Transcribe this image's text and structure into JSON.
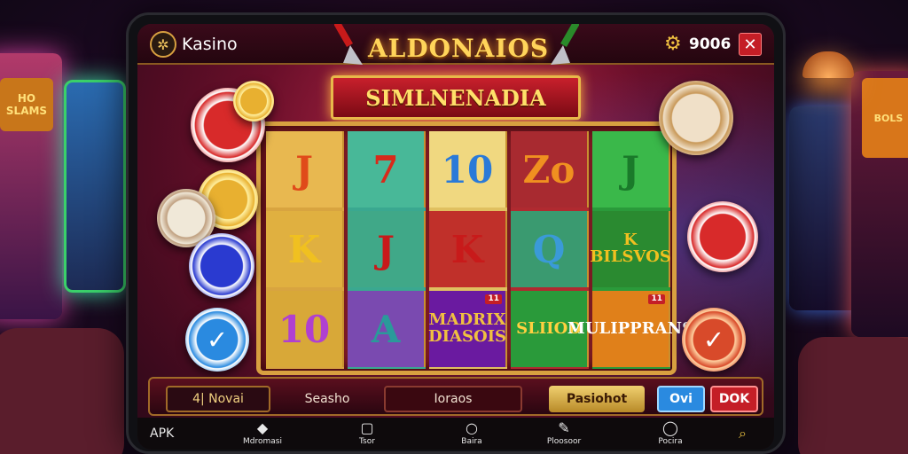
{
  "background": {
    "left_sign": "HO SLAMS",
    "right_sign": "BOLS"
  },
  "topbar": {
    "logo_glyph": "✲",
    "app_name": "Kasino",
    "title": "ALDONAIOS",
    "gear_icon": "gear-icon",
    "coins": "9006",
    "close_glyph": "✕"
  },
  "game": {
    "banner": "SIMLNENADIA"
  },
  "reels": [
    {
      "bg": "#d8a440",
      "cells": [
        {
          "text": "J",
          "color": "#e04a1a",
          "bg": "#e8b850"
        },
        {
          "text": "K",
          "color": "#f0c020",
          "bg": "#e0b040"
        },
        {
          "text": "10",
          "color": "#b040d0",
          "bg": "#d8a838"
        }
      ]
    },
    {
      "bg": "#3aa890",
      "cells": [
        {
          "text": "7",
          "color": "#d82a1a",
          "bg": "#48b898"
        },
        {
          "text": "J",
          "color": "#c81a1a",
          "bg": "#40a888"
        },
        {
          "text": "A",
          "color": "#2a9a9a",
          "bg": "#7a4ab0"
        }
      ]
    },
    {
      "bg": "#e0c060",
      "cells": [
        {
          "text": "10",
          "color": "#2a7ad8",
          "bg": "#f0d880"
        },
        {
          "text": "K",
          "color": "#c81a1a",
          "bg": "#c0302a"
        },
        {
          "text": "MADRIX DIASOIS",
          "color": "#f0c040",
          "bg": "#6a1aa0",
          "small": true,
          "badge": "11"
        }
      ]
    },
    {
      "bg": "#b02a30",
      "cells": [
        {
          "text": "Zo",
          "color": "#f09020",
          "bg": "#a82a30"
        },
        {
          "text": "Q",
          "color": "#3a9ad8",
          "bg": "#3a9a70"
        },
        {
          "text": "SLIIOD",
          "color": "#ffd040",
          "bg": "#2a9a3a",
          "small": true
        }
      ]
    },
    {
      "bg": "#2a9a3a",
      "cells": [
        {
          "text": "J",
          "color": "#1a7a2a",
          "bg": "#3ab84a"
        },
        {
          "text": "K BILSVOS",
          "color": "#f0c020",
          "bg": "#2a8a30",
          "small": true
        },
        {
          "text": "MULIPPRANS",
          "color": "#ffffff",
          "bg": "#e0801a",
          "small": true,
          "badge": "11"
        }
      ]
    }
  ],
  "chips": [
    {
      "label": "",
      "bg": "#d82a2a",
      "edge": "#ffffff"
    },
    {
      "label": "",
      "bg": "#e8b030",
      "edge": "#fff0a0"
    },
    {
      "label": "",
      "bg": "#e8b030",
      "edge": "#fff0a0"
    },
    {
      "label": "",
      "bg": "#f0e8d8",
      "edge": "#c0a080"
    },
    {
      "label": "",
      "bg": "#2a3ad0",
      "edge": "#ffffff"
    },
    {
      "label": "✓",
      "bg": "#2a8ae0",
      "edge": "#ffffff"
    },
    {
      "label": "",
      "bg": "#f0e0c8",
      "edge": "#c89858"
    },
    {
      "label": "",
      "bg": "#d82a2a",
      "edge": "#ffffff"
    },
    {
      "label": "✓",
      "bg": "#d84a2a",
      "edge": "#ffd0a0"
    }
  ],
  "controls": {
    "novai": "4| Novai",
    "seasho": "Seasho",
    "ioraos": "Ioraos",
    "pasiohot": "Pasiohot",
    "ok1": "Ovi",
    "ok2": "DOK"
  },
  "bottomnav": {
    "apk": "APK",
    "items": [
      {
        "label": "Mdromasi",
        "icon": "shield-icon",
        "glyph": "◆"
      },
      {
        "label": "Tsor",
        "icon": "window-icon",
        "glyph": "▢"
      },
      {
        "label": "Baira",
        "icon": "circle-icon",
        "glyph": "○"
      },
      {
        "label": "Ploosoor",
        "icon": "edit-icon",
        "glyph": "✎"
      },
      {
        "label": "Pocira",
        "icon": "globe-icon",
        "glyph": "◯"
      }
    ],
    "search_glyph": "⌕"
  },
  "colors": {
    "accent_gold": "#d8a040",
    "brand_red": "#c41e26",
    "ok_blue": "#2a8ae0"
  }
}
